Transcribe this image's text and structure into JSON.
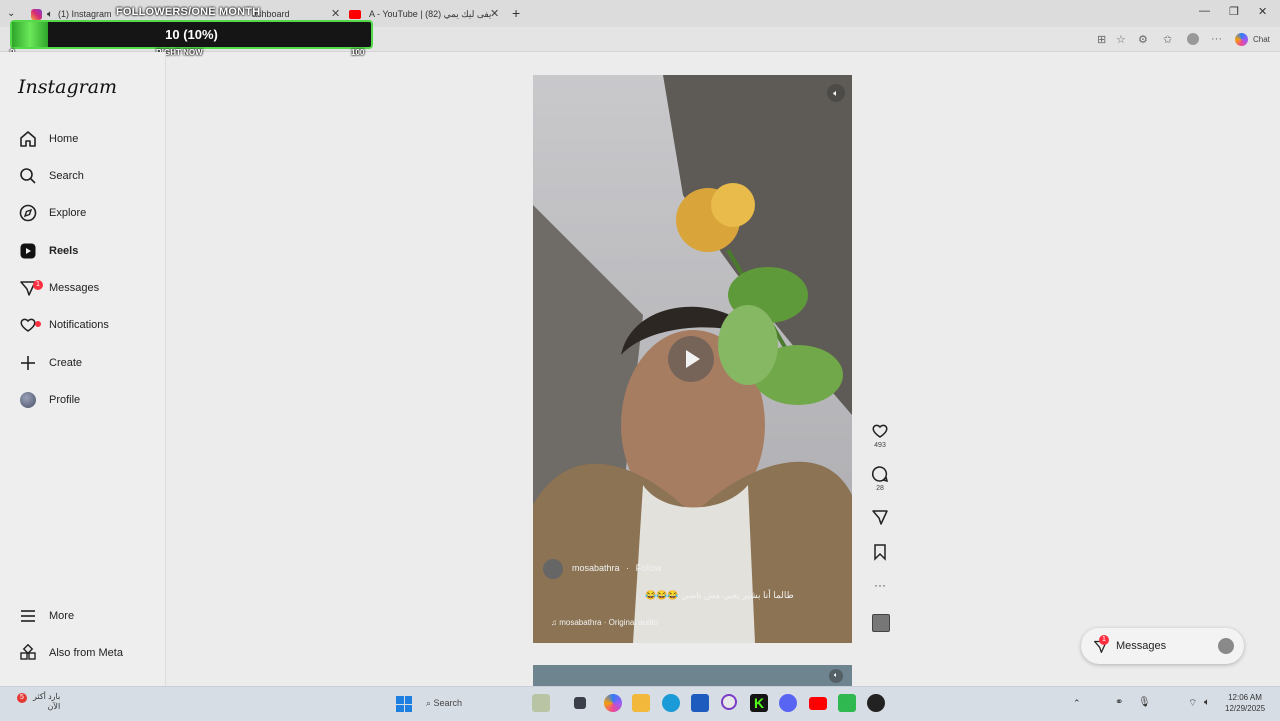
{
  "browser": {
    "tabs": [
      {
        "label": "(1) Instagram"
      },
      {
        "label": "ashboard"
      },
      {
        "label": "A - YouTube | يفى ليك يمي (82)"
      }
    ],
    "new_tab_label": "+",
    "chat_label": "Chat"
  },
  "overlay": {
    "title": "FOLLOWERS/ONE MONTH",
    "value_text": "10 (10%)",
    "progress_fraction": 0.1,
    "min_label": "0",
    "mid_label": "RIGHT NOW",
    "max_label": "100"
  },
  "sidebar": {
    "logo": "Instagram",
    "items": [
      {
        "label": "Home",
        "icon": "home-icon"
      },
      {
        "label": "Search",
        "icon": "search-icon"
      },
      {
        "label": "Explore",
        "icon": "compass-icon"
      },
      {
        "label": "Reels",
        "icon": "reels-icon"
      },
      {
        "label": "Messages",
        "icon": "messages-icon",
        "badge": "1"
      },
      {
        "label": "Notifications",
        "icon": "heart-icon"
      },
      {
        "label": "Create",
        "icon": "plus-icon"
      },
      {
        "label": "Profile",
        "icon": "avatar-icon"
      }
    ],
    "more_label": "More",
    "meta_label": "Also from Meta"
  },
  "reel": {
    "username": "mosabathra",
    "follow_label": "Follow",
    "caption": "طالما أنا بشير يعني مش ناسي 😂😂😂",
    "audio": "mosabathra · Original audio",
    "likes": "493",
    "comments": "28"
  },
  "messages_pill": {
    "label": "Messages",
    "badge": "1"
  },
  "taskbar": {
    "weather_temp": "5",
    "weather_line1": "بارد أكثر",
    "weather_line2": "الآن",
    "search_placeholder": "Search",
    "time": "12:06 AM",
    "date": "12/29/2025"
  },
  "colors": {
    "accent_green": "#54d94a",
    "badge_red": "#ff3040"
  }
}
